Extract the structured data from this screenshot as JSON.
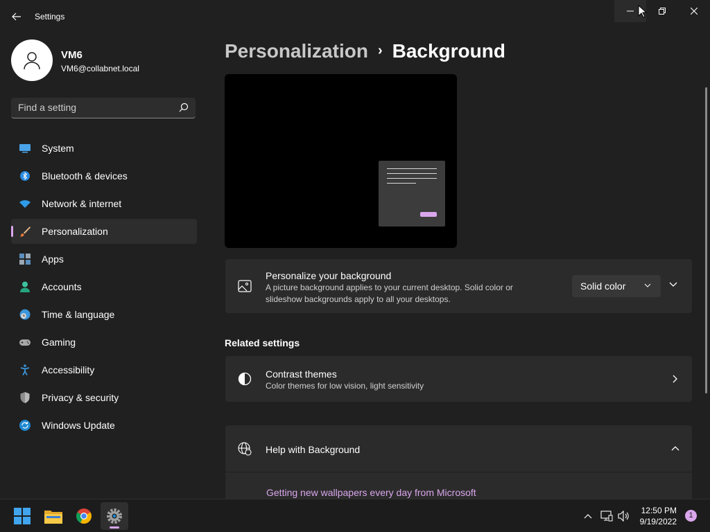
{
  "window": {
    "title": "Settings"
  },
  "profile": {
    "name": "VM6",
    "email": "VM6@collabnet.local"
  },
  "search": {
    "placeholder": "Find a setting"
  },
  "sidebar": {
    "items": [
      {
        "label": "System",
        "icon": "system-icon",
        "selected": false
      },
      {
        "label": "Bluetooth & devices",
        "icon": "bluetooth-icon",
        "selected": false
      },
      {
        "label": "Network & internet",
        "icon": "wifi-icon",
        "selected": false
      },
      {
        "label": "Personalization",
        "icon": "brush-icon",
        "selected": true
      },
      {
        "label": "Apps",
        "icon": "apps-icon",
        "selected": false
      },
      {
        "label": "Accounts",
        "icon": "person-icon",
        "selected": false
      },
      {
        "label": "Time & language",
        "icon": "globe-clock-icon",
        "selected": false
      },
      {
        "label": "Gaming",
        "icon": "gamepad-icon",
        "selected": false
      },
      {
        "label": "Accessibility",
        "icon": "accessibility-icon",
        "selected": false
      },
      {
        "label": "Privacy & security",
        "icon": "shield-icon",
        "selected": false
      },
      {
        "label": "Windows Update",
        "icon": "update-icon",
        "selected": false
      }
    ]
  },
  "breadcrumb": {
    "parent": "Personalization",
    "separator": "›",
    "current": "Background"
  },
  "background_card": {
    "title": "Personalize your background",
    "description": "A picture background applies to your current desktop. Solid color or slideshow backgrounds apply to all your desktops.",
    "dropdown_value": "Solid color"
  },
  "related": {
    "heading": "Related settings",
    "contrast_title": "Contrast themes",
    "contrast_desc": "Color themes for low vision, light sensitivity"
  },
  "help": {
    "title": "Help with Background",
    "link": "Getting new wallpapers every day from Microsoft"
  },
  "taskbar": {
    "apps": [
      "start-icon",
      "file-explorer-icon",
      "chrome-icon",
      "settings-icon"
    ],
    "time": "12:50 PM",
    "date": "9/19/2022",
    "notification_count": "1"
  },
  "colors": {
    "accent": "#d9a6ec",
    "background": "#202020",
    "card": "#2b2b2b"
  }
}
